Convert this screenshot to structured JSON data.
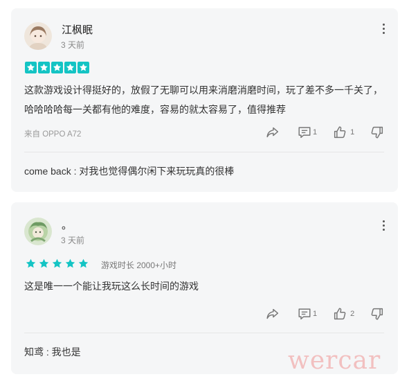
{
  "reviews": [
    {
      "username": "江枫眠",
      "time": "3 天前",
      "rating": 5,
      "playtime": "",
      "content": "这款游戏设计得挺好的，放假了无聊可以用来消磨消磨时间，玩了差不多一千关了，哈哈哈哈每一关都有他的难度，容易的就太容易了，值得推荐",
      "source": "来自 OPPO A72",
      "comment_count": "1",
      "like_count": "1",
      "reply": "come back : 对我也觉得偶尔闲下来玩玩真的很棒"
    },
    {
      "username": "。",
      "time": "3 天前",
      "rating": 5,
      "playtime": "游戏时长 2000+小时",
      "content": "这是唯一一个能让我玩这么长时间的游戏",
      "source": "",
      "comment_count": "1",
      "like_count": "2",
      "reply": "知鸢 : 我也是"
    }
  ],
  "watermark": "wercar",
  "colors": {
    "star": "#14c4c4",
    "card_bg": "#f5f6f7"
  }
}
